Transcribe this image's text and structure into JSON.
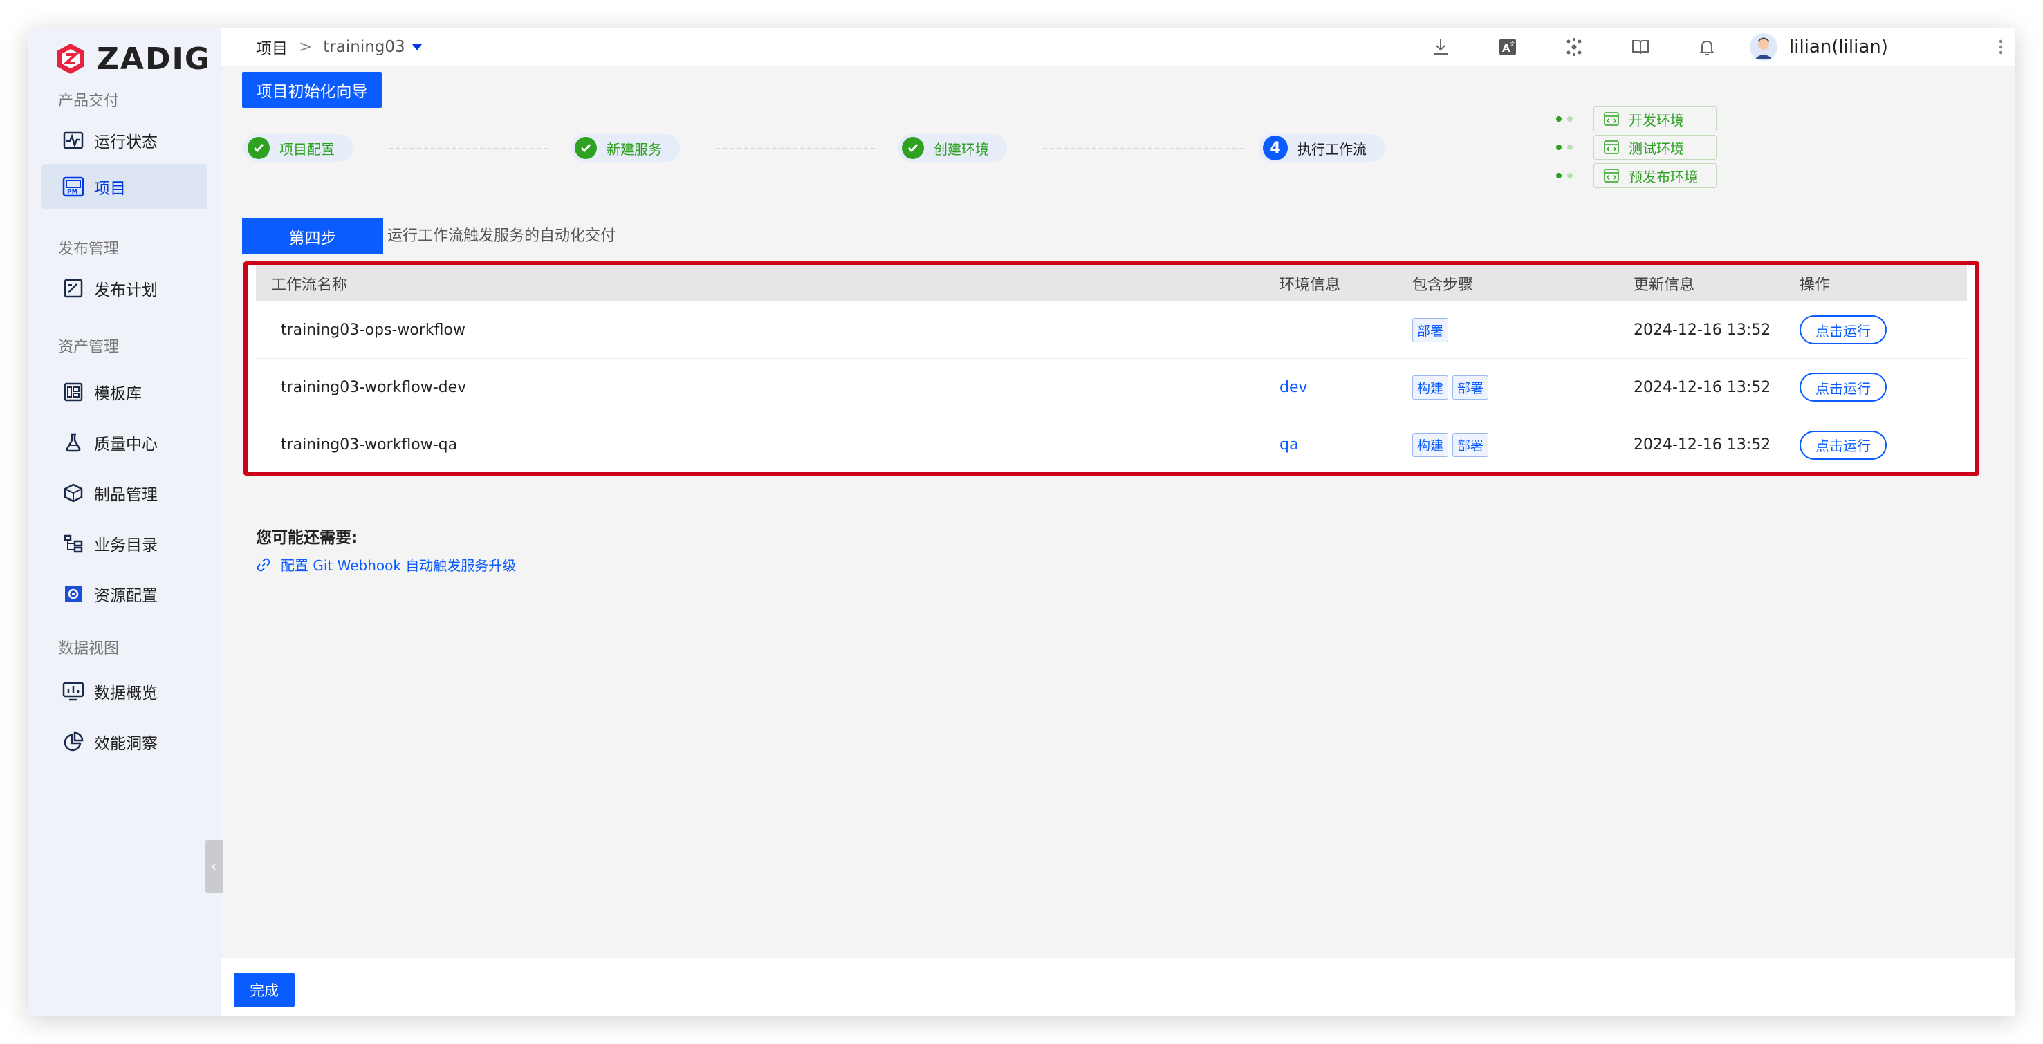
{
  "brand": {
    "name": "ZADIG"
  },
  "sidebar": {
    "sections": [
      {
        "title": "产品交付",
        "items": [
          {
            "label": "运行状态",
            "icon": "pulse-monitor-icon",
            "active": false
          },
          {
            "label": "项目",
            "icon": "project-pm-icon",
            "active": true
          }
        ]
      },
      {
        "title": "发布管理",
        "items": [
          {
            "label": "发布计划",
            "icon": "release-plan-icon",
            "active": false
          }
        ]
      },
      {
        "title": "资产管理",
        "items": [
          {
            "label": "模板库",
            "icon": "template-library-icon",
            "active": false
          },
          {
            "label": "质量中心",
            "icon": "flask-icon",
            "active": false
          },
          {
            "label": "制品管理",
            "icon": "artifact-box-icon",
            "active": false
          },
          {
            "label": "业务目录",
            "icon": "business-tree-icon",
            "active": false
          },
          {
            "label": "资源配置",
            "icon": "settings-gear-icon",
            "active": false
          }
        ]
      },
      {
        "title": "数据视图",
        "items": [
          {
            "label": "数据概览",
            "icon": "dashboard-monitor-icon",
            "active": false
          },
          {
            "label": "效能洞察",
            "icon": "pie-chart-icon",
            "active": false
          }
        ]
      }
    ]
  },
  "header": {
    "breadcrumb": {
      "root": "项目",
      "separator": ">",
      "project": "training03"
    },
    "icons": [
      "download-icon",
      "translate-icon",
      "network-icon",
      "docs-book-icon",
      "bell-icon"
    ],
    "user": "lilian(lilian)"
  },
  "wizard": {
    "button": "项目初始化向导",
    "steps": [
      {
        "label": "项目配置",
        "status": "done"
      },
      {
        "label": "新建服务",
        "status": "done"
      },
      {
        "label": "创建环境",
        "status": "done"
      },
      {
        "label": "执行工作流",
        "status": "current",
        "number": "4"
      }
    ],
    "environments": [
      "开发环境",
      "测试环境",
      "预发布环境"
    ],
    "current_step": {
      "title": "第四步",
      "description": "运行工作流触发服务的自动化交付"
    }
  },
  "table": {
    "columns": [
      "工作流名称",
      "环境信息",
      "包含步骤",
      "更新信息",
      "操作"
    ],
    "rows": [
      {
        "name": "training03-ops-workflow",
        "env": "",
        "steps": [
          "部署"
        ],
        "updated": "2024-12-16 13:52",
        "action": "点击运行"
      },
      {
        "name": "training03-workflow-dev",
        "env": "dev",
        "steps": [
          "构建",
          "部署"
        ],
        "updated": "2024-12-16 13:52",
        "action": "点击运行"
      },
      {
        "name": "training03-workflow-qa",
        "env": "qa",
        "steps": [
          "构建",
          "部署"
        ],
        "updated": "2024-12-16 13:52",
        "action": "点击运行"
      }
    ]
  },
  "hints": {
    "title": "您可能还需要:",
    "link": "配置 Git Webhook 自动触发服务升级"
  },
  "footer": {
    "done": "完成"
  },
  "colors": {
    "primary": "#0a5cff",
    "success": "#2ea121",
    "highlight": "#d0021b"
  }
}
